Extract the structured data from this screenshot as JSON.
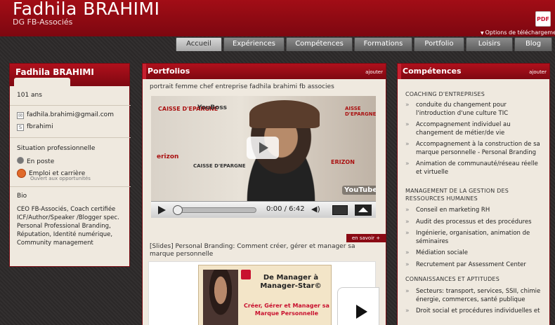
{
  "header": {
    "title": "Fadhila BRAHIMI",
    "subtitle": "DG FB-Associés",
    "download_label": "Options de téléchargement"
  },
  "nav": {
    "tabs": [
      "Accueil",
      "Expériences",
      "Compétences",
      "Formations",
      "Portfolio",
      "Loisirs",
      "Blog"
    ]
  },
  "profile": {
    "name": "Fadhila BRAHIMI",
    "age": "101 ans",
    "email": "fadhila.brahimi@gmail.com",
    "skype": "fbrahimi",
    "situation_label": "Situation professionnelle",
    "status": "En poste",
    "job_label": "Emploi et carrière",
    "job_sub": "Ouvert aux opportunités",
    "bio_label": "Bio",
    "bio": "CEO FB-Associés, Coach certifiée ICF/Author/Speaker /Blogger spec. Personal Professional Branding, Réputation, Identité numérique, Community management"
  },
  "portfolio": {
    "title": "Portfolios",
    "toggle": "ajouter",
    "item1_title": "portrait femme chef entreprise fadhila brahimi fb associes",
    "video": {
      "time": "0:00 / 6:42",
      "signs": [
        "CAISSE D'EPARGNE",
        "YouBoss",
        "AISSE D'EPARGNE",
        "CAISSE D'EPARGNE",
        "erizon",
        "ERIZON"
      ],
      "yt_label": "YouTube"
    },
    "more": "en savoir +",
    "item2_title": "[Slides] Personal Branding: Comment créer, gérer et manager sa marque personnelle",
    "slide": {
      "title": "De Manager à Manager-Star©",
      "subtitle": "Créer, Gérer et Manager sa Marque Personnelle"
    }
  },
  "competences": {
    "title": "Compétences",
    "toggle": "ajouter",
    "groups": [
      {
        "heading": "COACHING D'ENTREPRISES",
        "items": [
          "conduite du changement pour l'introduction d'une culture TIC",
          "Accompagnement individuel au changement de métier/de vie",
          "Accompagnement à la construction de sa marque personnelle - Personal Branding",
          "Animation de communauté/réseau réelle et virtuelle"
        ]
      },
      {
        "heading": "MANAGEMENT DE LA GESTION DES RESSOURCES HUMAINES",
        "items": [
          "Conseil en marketing RH",
          "Audit des processus et des procédures",
          "Ingénierie, organisation, animation de séminaires",
          "Médiation sociale",
          "Recrutement par Assessment Center"
        ]
      },
      {
        "heading": "CONNAISSANCES ET APTITUDES",
        "items": [
          "Secteurs: transport, services, SSII, chimie énergie, commerces, santé publique",
          "Droit social et procédures individuelles et"
        ]
      }
    ]
  },
  "colors": {
    "brand": "#9e0c15",
    "panel_bg": "#efe9df"
  }
}
